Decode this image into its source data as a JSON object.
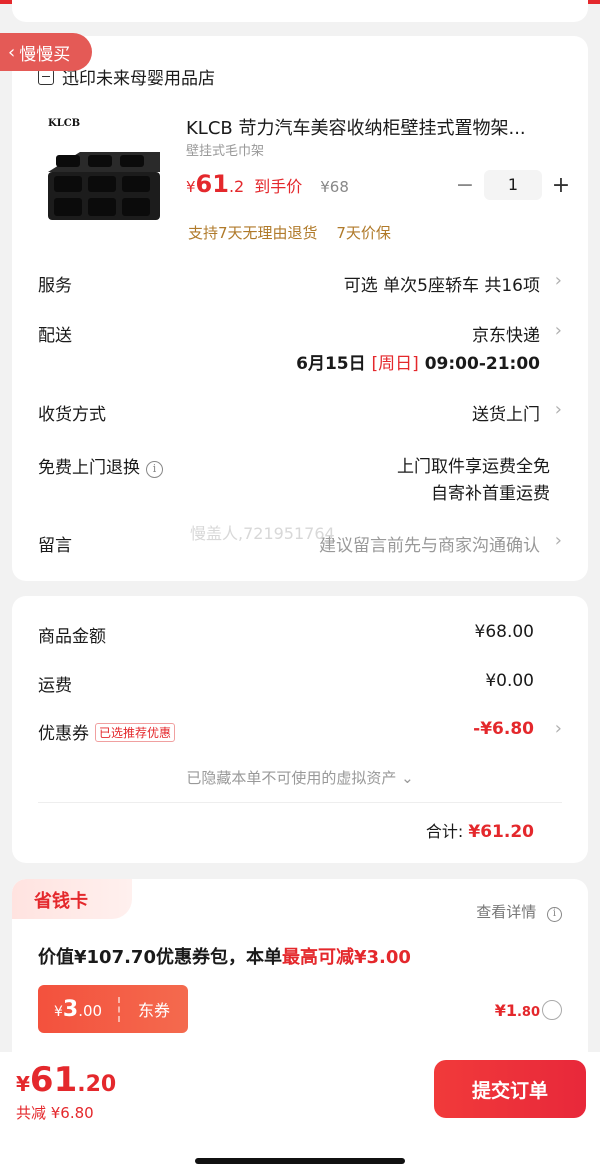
{
  "back_button": {
    "label": "慢慢买"
  },
  "store": {
    "name": "迅印未来母婴用品店"
  },
  "product": {
    "brand_logo": "KLCB",
    "title": "KLCB 苛力汽车美容收纳柜壁挂式置物架...",
    "spec": "壁挂式毛巾架",
    "price_currency": "¥",
    "price_int": "61",
    "price_dec": ".2",
    "price_tag": "到手价",
    "original_price": "¥68",
    "quantity": "1",
    "minus": "−",
    "plus": "+",
    "guarantees": [
      "支持7天无理由退货",
      "7天价保"
    ]
  },
  "rows": {
    "service": {
      "label": "服务",
      "value": "可选 单次5座轿车 共16项"
    },
    "delivery": {
      "label": "配送",
      "value": "京东快递",
      "date": "6月15日",
      "weekday": "[周日]",
      "time": "09:00-21:00"
    },
    "receive": {
      "label": "收货方式",
      "value": "送货上门"
    },
    "return": {
      "label": "免费上门退换",
      "value_line1": "上门取件享运费全免",
      "value_line2": "自寄补首重运费"
    },
    "message": {
      "label": "留言",
      "placeholder": "建议留言前先与商家沟通确认"
    }
  },
  "watermark": "慢盖人,721951764",
  "amounts": {
    "goods": {
      "label": "商品金额",
      "value": "¥68.00"
    },
    "shipping": {
      "label": "运费",
      "value": "¥0.00"
    },
    "coupon": {
      "label": "优惠券",
      "badge": "已选推荐优惠",
      "value": "-¥6.80"
    },
    "hidden_assets": "已隐藏本单不可使用的虚拟资产",
    "total_label": "合计:",
    "total_value": "¥61.20"
  },
  "save_card": {
    "tag": "省钱卡",
    "detail": "查看详情",
    "headline_prefix": "价值¥107.70优惠券包，本单",
    "headline_highlight": "最高可减¥3.00",
    "coupon_currency": "¥",
    "coupon_int": "3",
    "coupon_dec": ".00",
    "coupon_type": "东券",
    "price_int": "¥1",
    "price_dec": ".80"
  },
  "bottom": {
    "total_currency": "¥",
    "total_int": "61",
    "total_dec": ".20",
    "discount": "共减 ¥6.80",
    "submit": "提交订单"
  },
  "colors": {
    "accent": "#e4282c",
    "guarantee": "#b07a2a",
    "background": "#f2f2f2"
  }
}
